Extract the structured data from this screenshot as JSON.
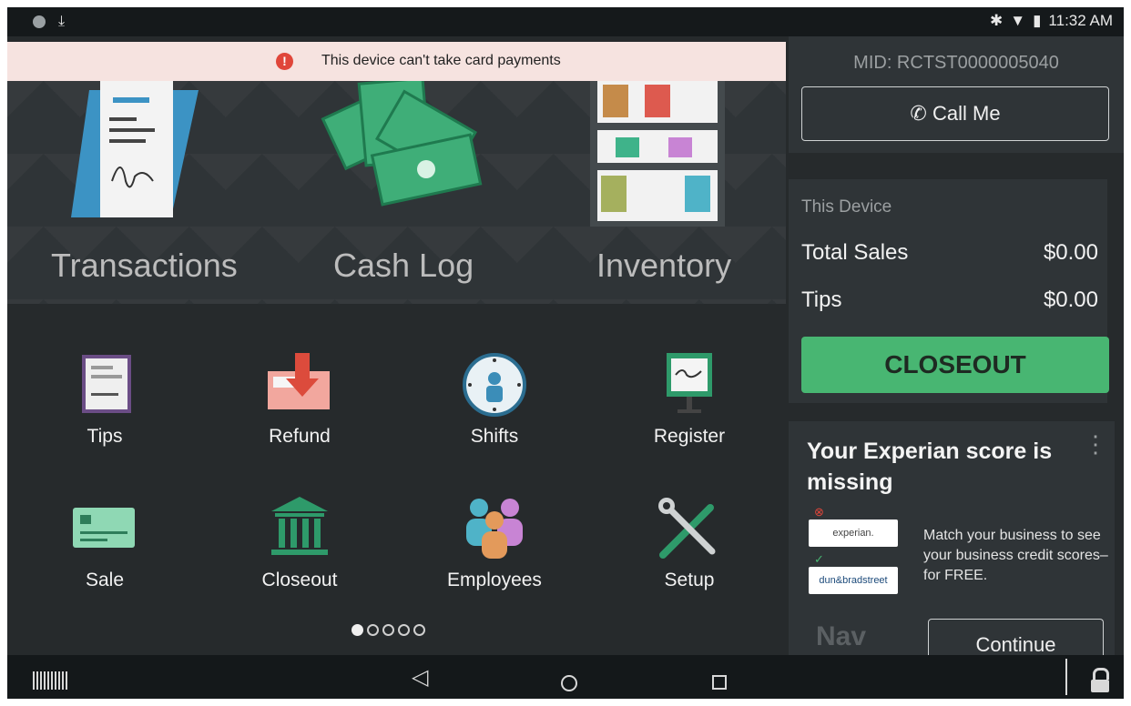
{
  "status_bar": {
    "time": "11:32 AM"
  },
  "banner": {
    "text": "This device can't take card payments",
    "icon": "alert-icon"
  },
  "hero": {
    "tiles": [
      {
        "label": "Transactions"
      },
      {
        "label": "Cash Log"
      },
      {
        "label": "Inventory"
      }
    ]
  },
  "apps": [
    {
      "label": "Tips",
      "icon": "tips-icon"
    },
    {
      "label": "Refund",
      "icon": "refund-icon"
    },
    {
      "label": "Shifts",
      "icon": "clock-icon"
    },
    {
      "label": "Register",
      "icon": "register-icon"
    },
    {
      "label": "Sale",
      "icon": "card-icon"
    },
    {
      "label": "Closeout",
      "icon": "bank-icon"
    },
    {
      "label": "Employees",
      "icon": "people-icon"
    },
    {
      "label": "Setup",
      "icon": "wrench-icon"
    }
  ],
  "pager": {
    "total": 5,
    "active": 1
  },
  "merchant": {
    "mid": "MID: RCTST0000005040",
    "call_label": "Call Me"
  },
  "device": {
    "title": "This Device",
    "total_sales_label": "Total Sales",
    "total_sales_value": "$0.00",
    "tips_label": "Tips",
    "tips_value": "$0.00",
    "closeout_label": "CLOSEOUT"
  },
  "experian": {
    "title": "Your Experian score is missing",
    "description": "Match your business to see your business credit scores–for FREE.",
    "logo1": "experian.",
    "logo2": "dun&bradstreet",
    "nav_logo": "Nav",
    "continue_label": "Continue"
  },
  "colors": {
    "accent_green": "#48b672",
    "alert_red": "#e0463a",
    "banner_bg": "#f6e3e0"
  }
}
